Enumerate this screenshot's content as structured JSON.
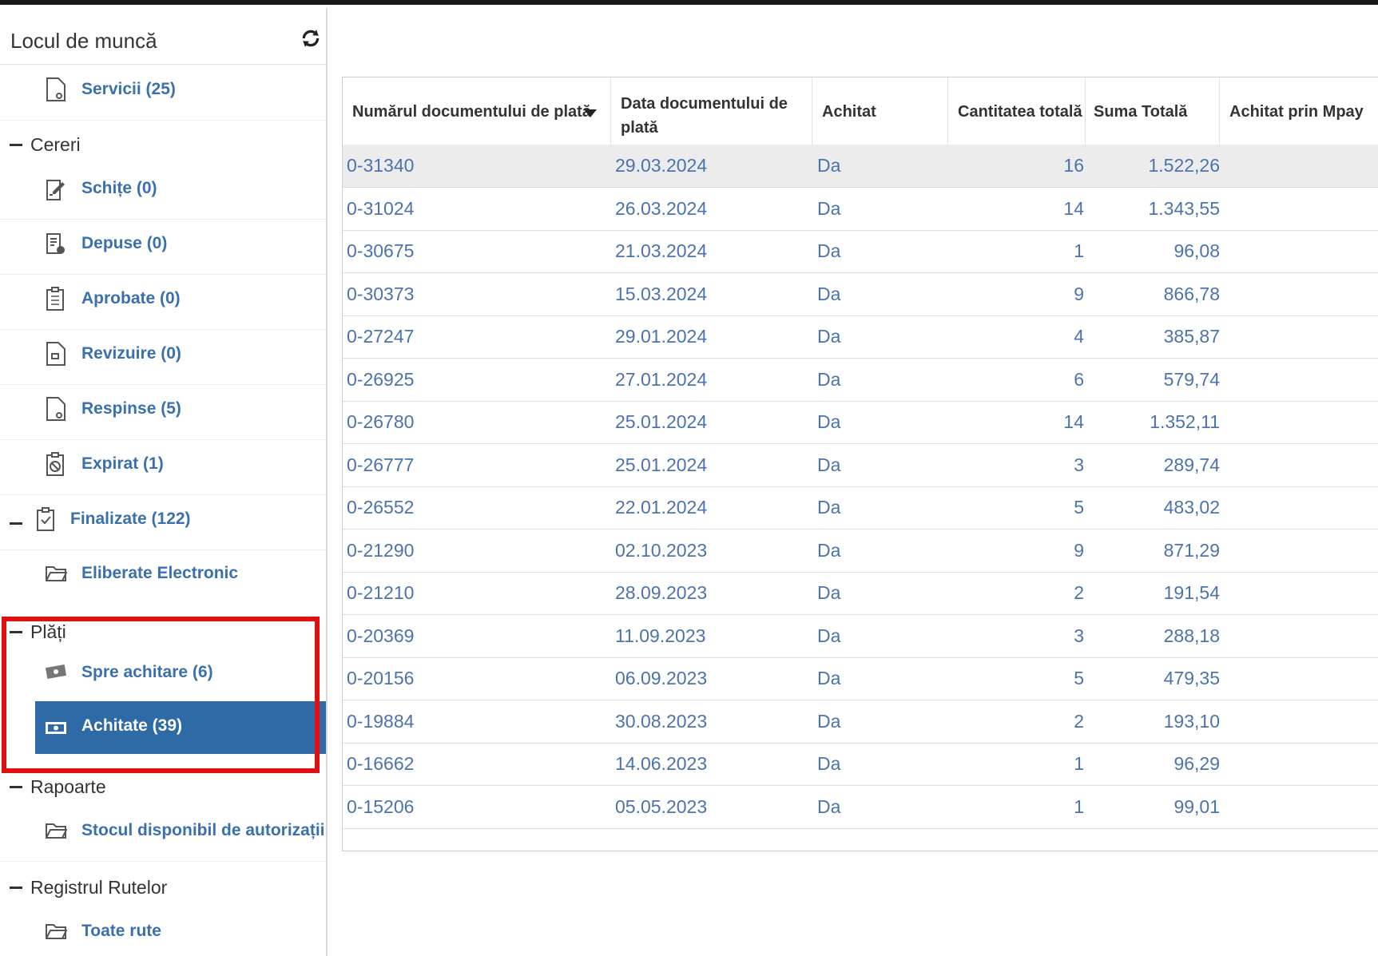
{
  "sidebar": {
    "title": "Locul de muncă",
    "servicii": "Servicii (25)",
    "cereri": {
      "label": "Cereri",
      "items": [
        "Schițe (0)",
        "Depuse (0)",
        "Aprobate (0)",
        "Revizuire (0)",
        "Respinse (5)",
        "Expirat (1)"
      ]
    },
    "finalizate": "Finalizate (122)",
    "eliberate": "Eliberate Electronic",
    "plati": {
      "label": "Plăți",
      "spre_achitare": "Spre achitare (6)",
      "achitate": "Achitate (39)"
    },
    "rapoarte": {
      "label": "Rapoarte",
      "stocul": "Stocul disponibil de autorizații"
    },
    "registrul": {
      "label": "Registrul Rutelor",
      "toate_rute": "Toate rute"
    }
  },
  "table": {
    "columns": [
      "Numărul documentului de plată",
      "Data documentului de plată",
      "Achitat",
      "Cantitatea totală",
      "Suma Totală",
      "Achitat prin Mpay"
    ],
    "rows": [
      [
        "0-31340",
        "29.03.2024",
        "Da",
        "16",
        "1.522,26"
      ],
      [
        "0-31024",
        "26.03.2024",
        "Da",
        "14",
        "1.343,55"
      ],
      [
        "0-30675",
        "21.03.2024",
        "Da",
        "1",
        "96,08"
      ],
      [
        "0-30373",
        "15.03.2024",
        "Da",
        "9",
        "866,78"
      ],
      [
        "0-27247",
        "29.01.2024",
        "Da",
        "4",
        "385,87"
      ],
      [
        "0-26925",
        "27.01.2024",
        "Da",
        "6",
        "579,74"
      ],
      [
        "0-26780",
        "25.01.2024",
        "Da",
        "14",
        "1.352,11"
      ],
      [
        "0-26777",
        "25.01.2024",
        "Da",
        "3",
        "289,74"
      ],
      [
        "0-26552",
        "22.01.2024",
        "Da",
        "5",
        "483,02"
      ],
      [
        "0-21290",
        "02.10.2023",
        "Da",
        "9",
        "871,29"
      ],
      [
        "0-21210",
        "28.09.2023",
        "Da",
        "2",
        "191,54"
      ],
      [
        "0-20369",
        "11.09.2023",
        "Da",
        "3",
        "288,18"
      ],
      [
        "0-20156",
        "06.09.2023",
        "Da",
        "5",
        "479,35"
      ],
      [
        "0-19884",
        "30.08.2023",
        "Da",
        "2",
        "193,10"
      ],
      [
        "0-16662",
        "14.06.2023",
        "Da",
        "1",
        "96,29"
      ],
      [
        "0-15206",
        "05.05.2023",
        "Da",
        "1",
        "99,01"
      ]
    ]
  },
  "colors": {
    "link": "#3a6fb0",
    "active_bg": "#2e6aa6",
    "highlight": "#e01010",
    "cell_text": "#4b73ad"
  },
  "icons": [
    "refresh-icon",
    "document-icon",
    "draft-icon",
    "submitted-icon",
    "clipboard-icon",
    "review-icon",
    "expired-icon",
    "check-clipboard-icon",
    "folder-icon",
    "money-icon",
    "cash-icon",
    "sort-desc-icon"
  ]
}
